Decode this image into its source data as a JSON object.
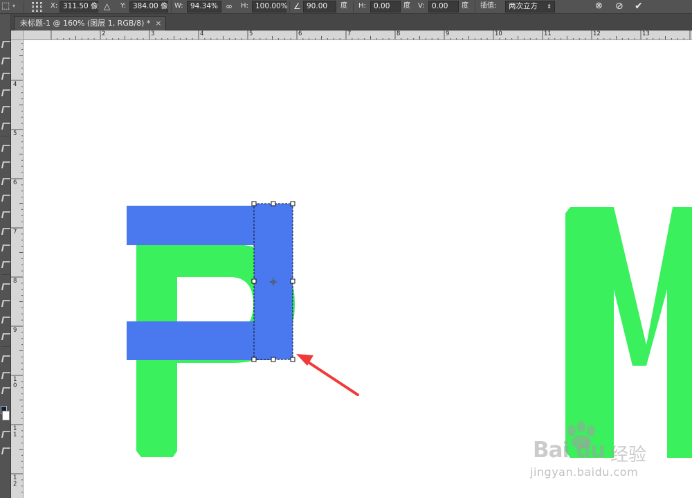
{
  "options_bar": {
    "x_label": "X:",
    "x_value": "311.50 像",
    "y_label": "Y:",
    "y_value": "384.00 像",
    "w_label": "W:",
    "w_value": "94.34%",
    "h_label": "H:",
    "h_value": "100.00%",
    "angle_value": "90.00",
    "angle_unit": "度",
    "skew_h_label": "H:",
    "skew_h_value": "0.00",
    "skew_h_unit": "度",
    "skew_v_label": "V:",
    "skew_v_value": "0.00",
    "skew_v_unit": "度",
    "interp_label": "插值:",
    "interp_value": "两次立方",
    "icons": [
      "reference-point-icon",
      "delta-icon",
      "link-icon",
      "angle-icon",
      "warp-icon",
      "cancel-icon",
      "commit-icon"
    ]
  },
  "document_tab": {
    "title": "未标题-1 @ 160% (图层 1, RGB/8) *",
    "close": "×"
  },
  "rulers": {
    "top_labels": [
      "2",
      "3",
      "4",
      "5",
      "6",
      "7",
      "8",
      "9",
      "10",
      "11",
      "12",
      "13",
      "14"
    ],
    "left_labels": [
      "4",
      "5",
      "6",
      "7",
      "8",
      "9",
      "1 0",
      "1 1",
      "1 2"
    ]
  },
  "canvas": {
    "letter_color": "#3af05d",
    "shape_color": "#4a78ee",
    "arrow_color": "#f03a3a",
    "background": "#ffffff"
  },
  "watermark": {
    "brand": "Bai du",
    "brand_cn": "经验",
    "url": "jingyan.baidu.com"
  }
}
